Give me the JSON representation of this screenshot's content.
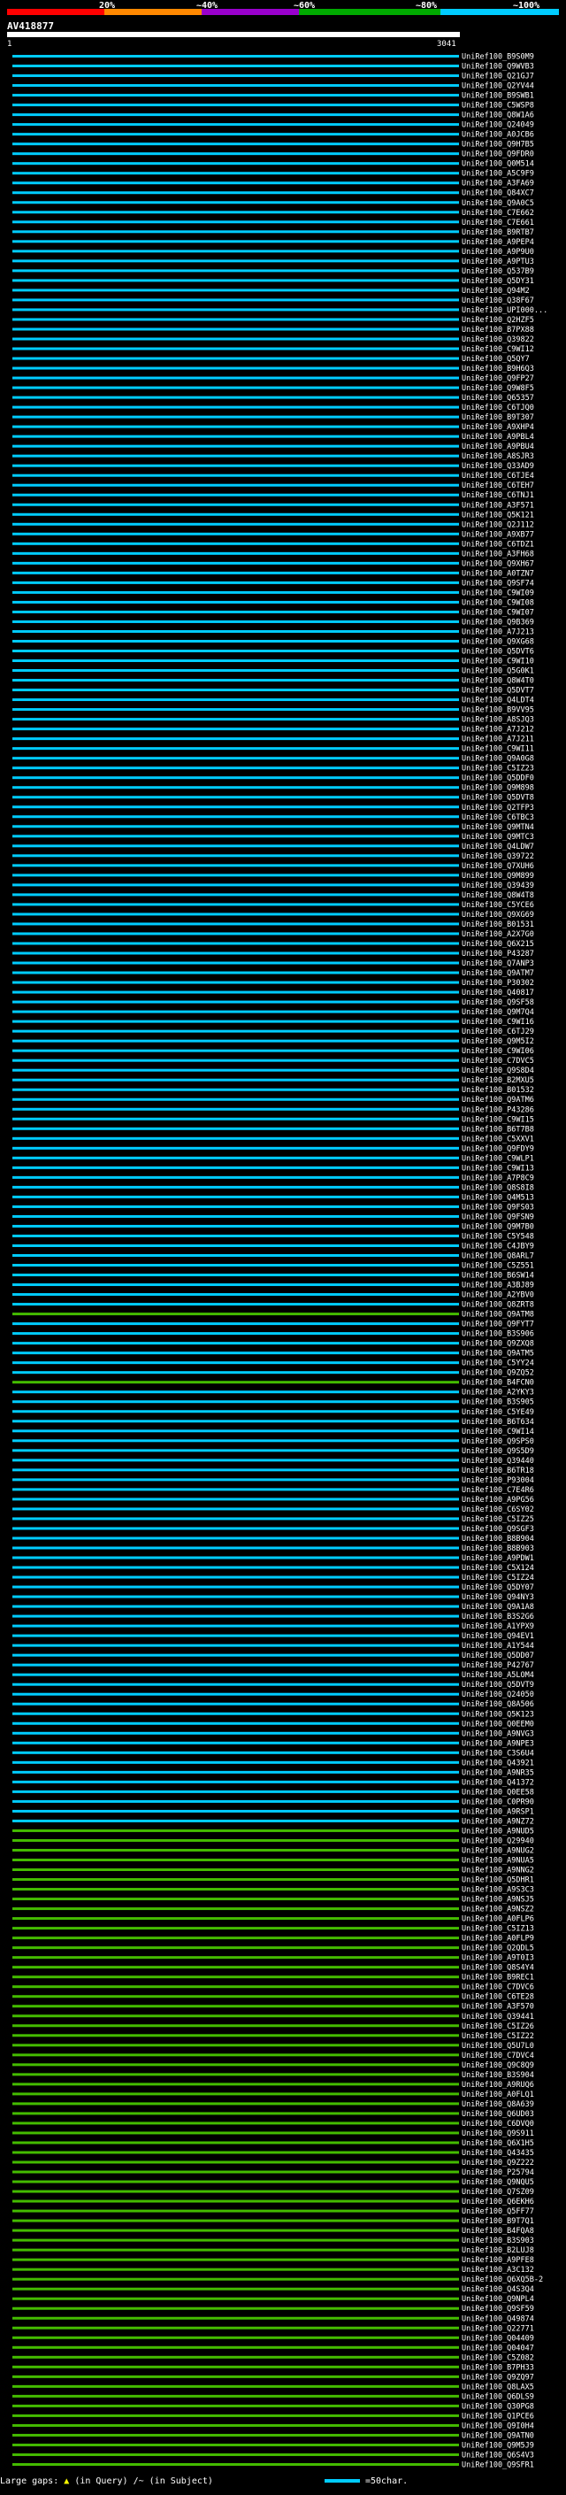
{
  "legend": {
    "ticks": [
      "20%",
      "~40%",
      "~60%",
      "~80%",
      "~100%"
    ],
    "colors": [
      "#ff0000",
      "#ff8800",
      "#9900cc",
      "#00aa00",
      "#00ccff"
    ]
  },
  "query": {
    "name": "AV418877",
    "start": "1",
    "end": "3041"
  },
  "footer": {
    "large_gaps": "Large gaps:",
    "in_query": "(in Query)",
    "in_subject": "(in Subject)",
    "scale": "=50char."
  },
  "chart_data": {
    "type": "alignment",
    "rows": [
      {
        "label": "UniRef100_B9S0M9",
        "color": "cyan"
      },
      {
        "label": "UniRef100_Q9WVB3",
        "color": "cyan"
      },
      {
        "label": "UniRef100_Q21GJ7",
        "color": "cyan"
      },
      {
        "label": "UniRef100_Q2YV44",
        "color": "cyan"
      },
      {
        "label": "UniRef100_B9SWB1",
        "color": "cyan"
      },
      {
        "label": "UniRef100_C5WSP8",
        "color": "cyan"
      },
      {
        "label": "UniRef100_Q8W1A6",
        "color": "cyan"
      },
      {
        "label": "UniRef100_Q24049",
        "color": "cyan"
      },
      {
        "label": "UniRef100_A0JCB6",
        "color": "cyan"
      },
      {
        "label": "UniRef100_Q9H7B5",
        "color": "cyan"
      },
      {
        "label": "UniRef100_Q9FDR0",
        "color": "cyan"
      },
      {
        "label": "UniRef100_Q0M514",
        "color": "cyan"
      },
      {
        "label": "UniRef100_A5C9F9",
        "color": "cyan"
      },
      {
        "label": "UniRef100_A3FA69",
        "color": "cyan"
      },
      {
        "label": "UniRef100_Q84XC7",
        "color": "cyan"
      },
      {
        "label": "UniRef100_Q9A0C5",
        "color": "cyan"
      },
      {
        "label": "UniRef100_C7E662",
        "color": "cyan"
      },
      {
        "label": "UniRef100_C7E661",
        "color": "cyan"
      },
      {
        "label": "UniRef100_B9RTB7",
        "color": "cyan"
      },
      {
        "label": "UniRef100_A9PEP4",
        "color": "cyan"
      },
      {
        "label": "UniRef100_A9P9U0",
        "color": "cyan"
      },
      {
        "label": "UniRef100_A9PTU3",
        "color": "cyan"
      },
      {
        "label": "UniRef100_Q537B9",
        "color": "cyan"
      },
      {
        "label": "UniRef100_Q5DY31",
        "color": "cyan"
      },
      {
        "label": "UniRef100_Q94M2",
        "color": "cyan"
      },
      {
        "label": "UniRef100_Q38F67",
        "color": "cyan"
      },
      {
        "label": "UniRef100_UPI000...",
        "color": "cyan"
      },
      {
        "label": "UniRef100_Q2HZF5",
        "color": "cyan"
      },
      {
        "label": "UniRef100_B7PX88",
        "color": "cyan"
      },
      {
        "label": "UniRef100_Q39822",
        "color": "cyan"
      },
      {
        "label": "UniRef100_C9WI12",
        "color": "cyan"
      },
      {
        "label": "UniRef100_Q5QY7",
        "color": "cyan"
      },
      {
        "label": "UniRef100_B9H6Q3",
        "color": "cyan"
      },
      {
        "label": "UniRef100_Q9FP27",
        "color": "cyan"
      },
      {
        "label": "UniRef100_Q9W8F5",
        "color": "cyan"
      },
      {
        "label": "UniRef100_Q65357",
        "color": "cyan"
      },
      {
        "label": "UniRef100_C6TJQ0",
        "color": "cyan"
      },
      {
        "label": "UniRef100_B9T307",
        "color": "cyan"
      },
      {
        "label": "UniRef100_A9XHP4",
        "color": "cyan"
      },
      {
        "label": "UniRef100_A9PBL4",
        "color": "cyan"
      },
      {
        "label": "UniRef100_A9PBU4",
        "color": "cyan"
      },
      {
        "label": "UniRef100_A8SJR3",
        "color": "cyan"
      },
      {
        "label": "UniRef100_Q33AD9",
        "color": "cyan"
      },
      {
        "label": "UniRef100_C6TJE4",
        "color": "cyan"
      },
      {
        "label": "UniRef100_C6TEH7",
        "color": "cyan"
      },
      {
        "label": "UniRef100_C6TNJ1",
        "color": "cyan"
      },
      {
        "label": "UniRef100_A3F571",
        "color": "cyan"
      },
      {
        "label": "UniRef100_Q5K121",
        "color": "cyan"
      },
      {
        "label": "UniRef100_Q2J112",
        "color": "cyan"
      },
      {
        "label": "UniRef100_A9XB77",
        "color": "cyan"
      },
      {
        "label": "UniRef100_C6TDZ1",
        "color": "cyan"
      },
      {
        "label": "UniRef100_A3FH68",
        "color": "cyan"
      },
      {
        "label": "UniRef100_Q9XH67",
        "color": "cyan"
      },
      {
        "label": "UniRef100_A0TZN7",
        "color": "cyan"
      },
      {
        "label": "UniRef100_Q9SF74",
        "color": "cyan"
      },
      {
        "label": "UniRef100_C9WI09",
        "color": "cyan"
      },
      {
        "label": "UniRef100_C9WI08",
        "color": "cyan"
      },
      {
        "label": "UniRef100_C9WI07",
        "color": "cyan"
      },
      {
        "label": "UniRef100_Q9B369",
        "color": "cyan"
      },
      {
        "label": "UniRef100_A7J213",
        "color": "cyan"
      },
      {
        "label": "UniRef100_Q9XG68",
        "color": "cyan"
      },
      {
        "label": "UniRef100_Q5DVT6",
        "color": "cyan"
      },
      {
        "label": "UniRef100_C9WI10",
        "color": "cyan"
      },
      {
        "label": "UniRef100_Q5G0K1",
        "color": "cyan"
      },
      {
        "label": "UniRef100_Q8W4T0",
        "color": "cyan"
      },
      {
        "label": "UniRef100_Q5DVT7",
        "color": "cyan"
      },
      {
        "label": "UniRef100_Q4LDT4",
        "color": "cyan"
      },
      {
        "label": "UniRef100_B9VV95",
        "color": "cyan"
      },
      {
        "label": "UniRef100_A8SJQ3",
        "color": "cyan"
      },
      {
        "label": "UniRef100_A7J212",
        "color": "cyan"
      },
      {
        "label": "UniRef100_A7J211",
        "color": "cyan"
      },
      {
        "label": "UniRef100_C9WI11",
        "color": "cyan"
      },
      {
        "label": "UniRef100_Q9A0G8",
        "color": "cyan"
      },
      {
        "label": "UniRef100_C5IZ23",
        "color": "cyan"
      },
      {
        "label": "UniRef100_Q5DDF0",
        "color": "cyan"
      },
      {
        "label": "UniRef100_Q9M898",
        "color": "cyan"
      },
      {
        "label": "UniRef100_Q5DVT8",
        "color": "cyan"
      },
      {
        "label": "UniRef100_Q2TFP3",
        "color": "cyan"
      },
      {
        "label": "UniRef100_C6TBC3",
        "color": "cyan"
      },
      {
        "label": "UniRef100_Q9MTN4",
        "color": "cyan"
      },
      {
        "label": "UniRef100_Q9MTC3",
        "color": "cyan"
      },
      {
        "label": "UniRef100_Q4LDW7",
        "color": "cyan"
      },
      {
        "label": "UniRef100_Q39722",
        "color": "cyan"
      },
      {
        "label": "UniRef100_Q7XUH6",
        "color": "cyan"
      },
      {
        "label": "UniRef100_Q9M899",
        "color": "cyan"
      },
      {
        "label": "UniRef100_Q39439",
        "color": "cyan"
      },
      {
        "label": "UniRef100_Q8W4T8",
        "color": "cyan"
      },
      {
        "label": "UniRef100_C5YCE6",
        "color": "cyan"
      },
      {
        "label": "UniRef100_Q9XG69",
        "color": "cyan"
      },
      {
        "label": "UniRef100_B01531",
        "color": "cyan"
      },
      {
        "label": "UniRef100_A2X7G0",
        "color": "cyan"
      },
      {
        "label": "UniRef100_Q6X215",
        "color": "cyan"
      },
      {
        "label": "UniRef100_P43287",
        "color": "cyan"
      },
      {
        "label": "UniRef100_Q7ANP3",
        "color": "cyan"
      },
      {
        "label": "UniRef100_Q9ATM7",
        "color": "cyan"
      },
      {
        "label": "UniRef100_P30302",
        "color": "cyan"
      },
      {
        "label": "UniRef100_Q40817",
        "color": "cyan"
      },
      {
        "label": "UniRef100_Q9SF58",
        "color": "cyan"
      },
      {
        "label": "UniRef100_Q9M7Q4",
        "color": "cyan"
      },
      {
        "label": "UniRef100_C9WI16",
        "color": "cyan"
      },
      {
        "label": "UniRef100_C6TJ29",
        "color": "cyan"
      },
      {
        "label": "UniRef100_Q9M5I2",
        "color": "cyan"
      },
      {
        "label": "UniRef100_C9WI06",
        "color": "cyan"
      },
      {
        "label": "UniRef100_C7DVC5",
        "color": "cyan"
      },
      {
        "label": "UniRef100_Q9S8D4",
        "color": "cyan"
      },
      {
        "label": "UniRef100_B2MXU5",
        "color": "cyan"
      },
      {
        "label": "UniRef100_B01532",
        "color": "cyan"
      },
      {
        "label": "UniRef100_Q9ATM6",
        "color": "cyan"
      },
      {
        "label": "UniRef100_P43286",
        "color": "cyan"
      },
      {
        "label": "UniRef100_C9WI15",
        "color": "cyan"
      },
      {
        "label": "UniRef100_B6T7B8",
        "color": "cyan"
      },
      {
        "label": "UniRef100_C5XXV1",
        "color": "cyan"
      },
      {
        "label": "UniRef100_Q9FDY9",
        "color": "cyan"
      },
      {
        "label": "UniRef100_C9WLP1",
        "color": "cyan"
      },
      {
        "label": "UniRef100_C9WI13",
        "color": "cyan"
      },
      {
        "label": "UniRef100_A7P8C9",
        "color": "cyan"
      },
      {
        "label": "UniRef100_Q8S8I8",
        "color": "cyan"
      },
      {
        "label": "UniRef100_Q4M513",
        "color": "cyan"
      },
      {
        "label": "UniRef100_Q9FS03",
        "color": "cyan"
      },
      {
        "label": "UniRef100_Q9FSN9",
        "color": "cyan"
      },
      {
        "label": "UniRef100_Q9M7B0",
        "color": "cyan"
      },
      {
        "label": "UniRef100_C5Y548",
        "color": "cyan"
      },
      {
        "label": "UniRef100_C4JBY9",
        "color": "cyan"
      },
      {
        "label": "UniRef100_Q8ARL7",
        "color": "cyan"
      },
      {
        "label": "UniRef100_C5Z551",
        "color": "cyan"
      },
      {
        "label": "UniRef100_B6SW14",
        "color": "cyan"
      },
      {
        "label": "UniRef100_A3BJ89",
        "color": "cyan"
      },
      {
        "label": "UniRef100_A2YBV0",
        "color": "cyan"
      },
      {
        "label": "UniRef100_Q8ZRT8",
        "color": "cyan"
      },
      {
        "label": "UniRef100_Q9ATM8",
        "color": "green"
      },
      {
        "label": "UniRef100_Q9FYT7",
        "color": "cyan"
      },
      {
        "label": "UniRef100_B3S906",
        "color": "cyan"
      },
      {
        "label": "UniRef100_Q9ZXQ8",
        "color": "cyan"
      },
      {
        "label": "UniRef100_Q9ATM5",
        "color": "cyan"
      },
      {
        "label": "UniRef100_C5YY24",
        "color": "cyan"
      },
      {
        "label": "UniRef100_Q9ZQ52",
        "color": "cyan"
      },
      {
        "label": "UniRef100_B4FCN0",
        "color": "green"
      },
      {
        "label": "UniRef100_A2YKY3",
        "color": "cyan"
      },
      {
        "label": "UniRef100_B3S905",
        "color": "cyan"
      },
      {
        "label": "UniRef100_C5YE49",
        "color": "cyan"
      },
      {
        "label": "UniRef100_B6T634",
        "color": "cyan"
      },
      {
        "label": "UniRef100_C9WI14",
        "color": "cyan"
      },
      {
        "label": "UniRef100_Q9SPS0",
        "color": "cyan"
      },
      {
        "label": "UniRef100_Q9S5D9",
        "color": "cyan"
      },
      {
        "label": "UniRef100_Q39440",
        "color": "cyan"
      },
      {
        "label": "UniRef100_B6TR18",
        "color": "cyan"
      },
      {
        "label": "UniRef100_P93004",
        "color": "cyan"
      },
      {
        "label": "UniRef100_C7E4R6",
        "color": "cyan"
      },
      {
        "label": "UniRef100_A9PG56",
        "color": "cyan"
      },
      {
        "label": "UniRef100_C6SY02",
        "color": "cyan"
      },
      {
        "label": "UniRef100_C5IZ25",
        "color": "cyan"
      },
      {
        "label": "UniRef100_Q9SGF3",
        "color": "cyan"
      },
      {
        "label": "UniRef100_B8B904",
        "color": "cyan"
      },
      {
        "label": "UniRef100_B8B903",
        "color": "cyan"
      },
      {
        "label": "UniRef100_A9PDW1",
        "color": "cyan"
      },
      {
        "label": "UniRef100_C5X124",
        "color": "cyan"
      },
      {
        "label": "UniRef100_C5IZ24",
        "color": "cyan"
      },
      {
        "label": "UniRef100_Q5DY07",
        "color": "cyan"
      },
      {
        "label": "UniRef100_Q94NY3",
        "color": "cyan"
      },
      {
        "label": "UniRef100_Q9A1A8",
        "color": "cyan"
      },
      {
        "label": "UniRef100_B3S2G6",
        "color": "cyan"
      },
      {
        "label": "UniRef100_A1YPX9",
        "color": "cyan"
      },
      {
        "label": "UniRef100_Q94EV1",
        "color": "cyan"
      },
      {
        "label": "UniRef100_A1Y544",
        "color": "cyan"
      },
      {
        "label": "UniRef100_Q5DD07",
        "color": "cyan"
      },
      {
        "label": "UniRef100_P42767",
        "color": "cyan"
      },
      {
        "label": "UniRef100_A5LOM4",
        "color": "cyan"
      },
      {
        "label": "UniRef100_Q5DVT9",
        "color": "cyan"
      },
      {
        "label": "UniRef100_Q24050",
        "color": "cyan"
      },
      {
        "label": "UniRef100_Q8A506",
        "color": "cyan"
      },
      {
        "label": "UniRef100_Q5K123",
        "color": "cyan"
      },
      {
        "label": "UniRef100_Q0EEM0",
        "color": "cyan"
      },
      {
        "label": "UniRef100_A9NVG3",
        "color": "cyan"
      },
      {
        "label": "UniRef100_A9NPE3",
        "color": "cyan"
      },
      {
        "label": "UniRef100_C3S6U4",
        "color": "cyan"
      },
      {
        "label": "UniRef100_Q43921",
        "color": "cyan"
      },
      {
        "label": "UniRef100_A9NR35",
        "color": "cyan"
      },
      {
        "label": "UniRef100_Q41372",
        "color": "cyan"
      },
      {
        "label": "UniRef100_Q0EE58",
        "color": "cyan"
      },
      {
        "label": "UniRef100_C0PR90",
        "color": "cyan"
      },
      {
        "label": "UniRef100_A9RSP1",
        "color": "cyan"
      },
      {
        "label": "UniRef100_A9NZ72",
        "color": "cyan"
      },
      {
        "label": "UniRef100_A9NUD5",
        "color": "green"
      },
      {
        "label": "UniRef100_Q29940",
        "color": "green"
      },
      {
        "label": "UniRef100_A9NUG2",
        "color": "green"
      },
      {
        "label": "UniRef100_A9NUA5",
        "color": "green"
      },
      {
        "label": "UniRef100_A9NNG2",
        "color": "green"
      },
      {
        "label": "UniRef100_Q5DHR1",
        "color": "green"
      },
      {
        "label": "UniRef100_A9S3C3",
        "color": "green"
      },
      {
        "label": "UniRef100_A9NSJ5",
        "color": "green"
      },
      {
        "label": "UniRef100_A9NSZ2",
        "color": "green"
      },
      {
        "label": "UniRef100_A0FLP6",
        "color": "green"
      },
      {
        "label": "UniRef100_C5IZ13",
        "color": "green"
      },
      {
        "label": "UniRef100_A0FLP9",
        "color": "green"
      },
      {
        "label": "UniRef100_Q2QDL5",
        "color": "green"
      },
      {
        "label": "UniRef100_A9T0I3",
        "color": "green"
      },
      {
        "label": "UniRef100_Q8S4Y4",
        "color": "green"
      },
      {
        "label": "UniRef100_B9REC1",
        "color": "green"
      },
      {
        "label": "UniRef100_C7DVC6",
        "color": "green"
      },
      {
        "label": "UniRef100_C6TE28",
        "color": "green"
      },
      {
        "label": "UniRef100_A3F570",
        "color": "green"
      },
      {
        "label": "UniRef100_Q39441",
        "color": "green"
      },
      {
        "label": "UniRef100_C5IZ26",
        "color": "green"
      },
      {
        "label": "UniRef100_C5IZ22",
        "color": "green"
      },
      {
        "label": "UniRef100_Q5U7L0",
        "color": "green"
      },
      {
        "label": "UniRef100_C7DVC4",
        "color": "green"
      },
      {
        "label": "UniRef100_Q9C8Q9",
        "color": "green"
      },
      {
        "label": "UniRef100_B3S904",
        "color": "green"
      },
      {
        "label": "UniRef100_A9RUQ6",
        "color": "green"
      },
      {
        "label": "UniRef100_A0FLQ1",
        "color": "green"
      },
      {
        "label": "UniRef100_Q8A639",
        "color": "green"
      },
      {
        "label": "UniRef100_Q6UD03",
        "color": "green"
      },
      {
        "label": "UniRef100_C6DVQ0",
        "color": "green"
      },
      {
        "label": "UniRef100_Q9S911",
        "color": "green"
      },
      {
        "label": "UniRef100_Q6X1H5",
        "color": "green"
      },
      {
        "label": "UniRef100_Q43435",
        "color": "green"
      },
      {
        "label": "UniRef100_Q9Z222",
        "color": "green"
      },
      {
        "label": "UniRef100_P25794",
        "color": "green"
      },
      {
        "label": "UniRef100_Q9NQU5",
        "color": "green"
      },
      {
        "label": "UniRef100_Q7SZ09",
        "color": "green"
      },
      {
        "label": "UniRef100_Q6EKH6",
        "color": "green"
      },
      {
        "label": "UniRef100_Q5FF77",
        "color": "green"
      },
      {
        "label": "UniRef100_B9T7Q1",
        "color": "green"
      },
      {
        "label": "UniRef100_B4FQA8",
        "color": "green"
      },
      {
        "label": "UniRef100_B3S903",
        "color": "green"
      },
      {
        "label": "UniRef100_B2LUJ8",
        "color": "green"
      },
      {
        "label": "UniRef100_A9PFE8",
        "color": "green"
      },
      {
        "label": "UniRef100_A3C132",
        "color": "green"
      },
      {
        "label": "UniRef100_Q6XQ5B-2",
        "color": "green"
      },
      {
        "label": "UniRef100_Q4S3Q4",
        "color": "green"
      },
      {
        "label": "UniRef100_Q9NPL4",
        "color": "green"
      },
      {
        "label": "UniRef100_Q9SF59",
        "color": "green"
      },
      {
        "label": "UniRef100_Q49874",
        "color": "green"
      },
      {
        "label": "UniRef100_Q22771",
        "color": "green"
      },
      {
        "label": "UniRef100_Q04409",
        "color": "green"
      },
      {
        "label": "UniRef100_Q04047",
        "color": "green"
      },
      {
        "label": "UniRef100_C5Z082",
        "color": "green"
      },
      {
        "label": "UniRef100_B7PH33",
        "color": "green"
      },
      {
        "label": "UniRef100_Q9ZQ97",
        "color": "green"
      },
      {
        "label": "UniRef100_Q8LAX5",
        "color": "green"
      },
      {
        "label": "UniRef100_Q6DLS9",
        "color": "green"
      },
      {
        "label": "UniRef100_Q30PG8",
        "color": "green"
      },
      {
        "label": "UniRef100_Q1PCE6",
        "color": "green"
      },
      {
        "label": "UniRef100_Q9I0H4",
        "color": "green"
      },
      {
        "label": "UniRef100_Q9ATN0",
        "color": "green"
      },
      {
        "label": "UniRef100_Q9M5J9",
        "color": "green"
      },
      {
        "label": "UniRef100_Q6S4V3",
        "color": "green"
      },
      {
        "label": "UniRef100_Q9SFR1",
        "color": "green"
      }
    ]
  }
}
